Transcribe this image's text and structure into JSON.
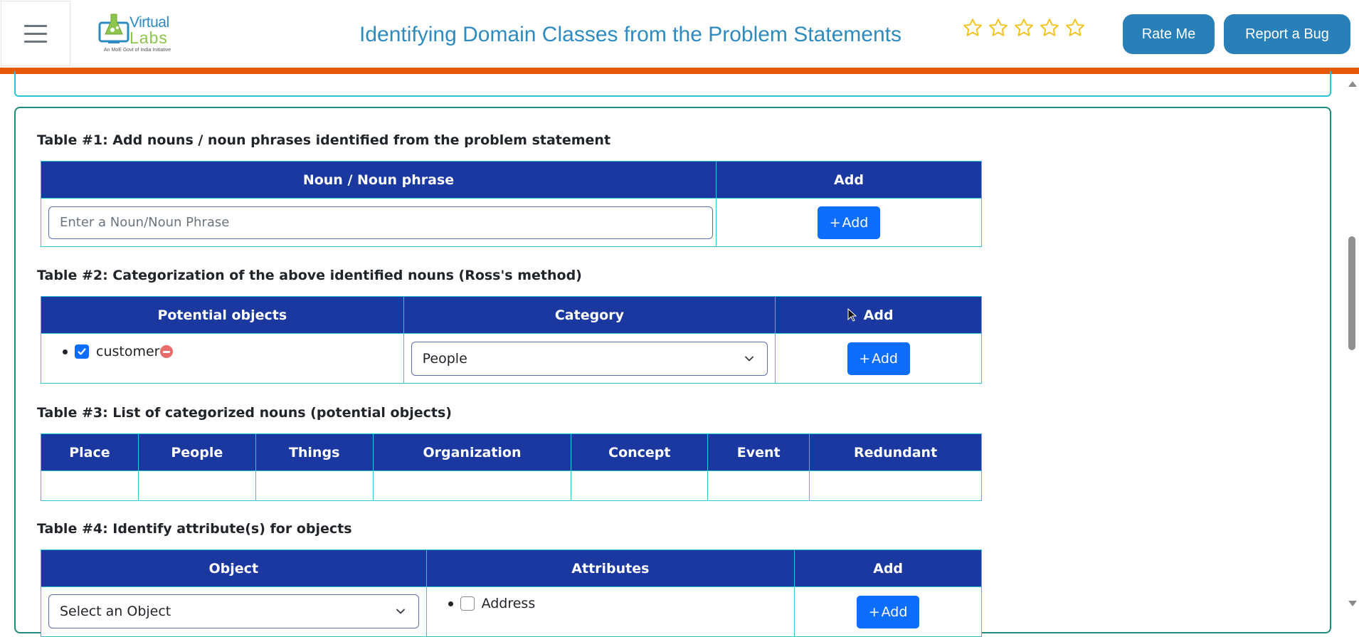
{
  "header": {
    "menu_icon": "hamburger-menu-icon",
    "logo": {
      "line1": "Virtual",
      "line2": "Labs",
      "tagline": "An MoE Govt of India Initiative"
    },
    "title": "Identifying Domain Classes from the Problem Statements",
    "rating": {
      "stars_total": 5,
      "stars_filled": 0,
      "star_color": "#f2c21b"
    },
    "rate_button": "Rate Me",
    "bug_button": "Report a Bug",
    "accent_bar_color": "#e8590c"
  },
  "table1": {
    "title": "Table #1: Add nouns / noun phrases identified from the problem statement",
    "headers": [
      "Noun / Noun phrase",
      "Add"
    ],
    "input_placeholder": "Enter a Noun/Noun Phrase",
    "input_value": "",
    "add_button": "Add"
  },
  "table2": {
    "title": "Table #2: Categorization of the above identified nouns (Ross's method)",
    "headers": [
      "Potential objects",
      "Category",
      "Add"
    ],
    "objects": [
      {
        "label": "customer",
        "checked": true
      }
    ],
    "category_selected": "People",
    "add_button": "Add"
  },
  "table3": {
    "title": "Table #3: List of categorized nouns (potential objects)",
    "headers": [
      "Place",
      "People",
      "Things",
      "Organization",
      "Concept",
      "Event",
      "Redundant"
    ],
    "row": [
      "",
      "",
      "",
      "",
      "",
      "",
      ""
    ]
  },
  "table4": {
    "title": "Table #4: Identify attribute(s) for objects",
    "headers": [
      "Object",
      "Attributes",
      "Add"
    ],
    "object_select": "Select an Object",
    "attributes": [
      {
        "label": "Address",
        "checked": false
      }
    ],
    "add_button": "Add"
  },
  "colors": {
    "table_header_bg": "#1a38a0",
    "table_border": "#2bc4d6",
    "primary_button": "#0d6efd",
    "title_color": "#2e8bc0",
    "header_button": "#2980b9"
  }
}
